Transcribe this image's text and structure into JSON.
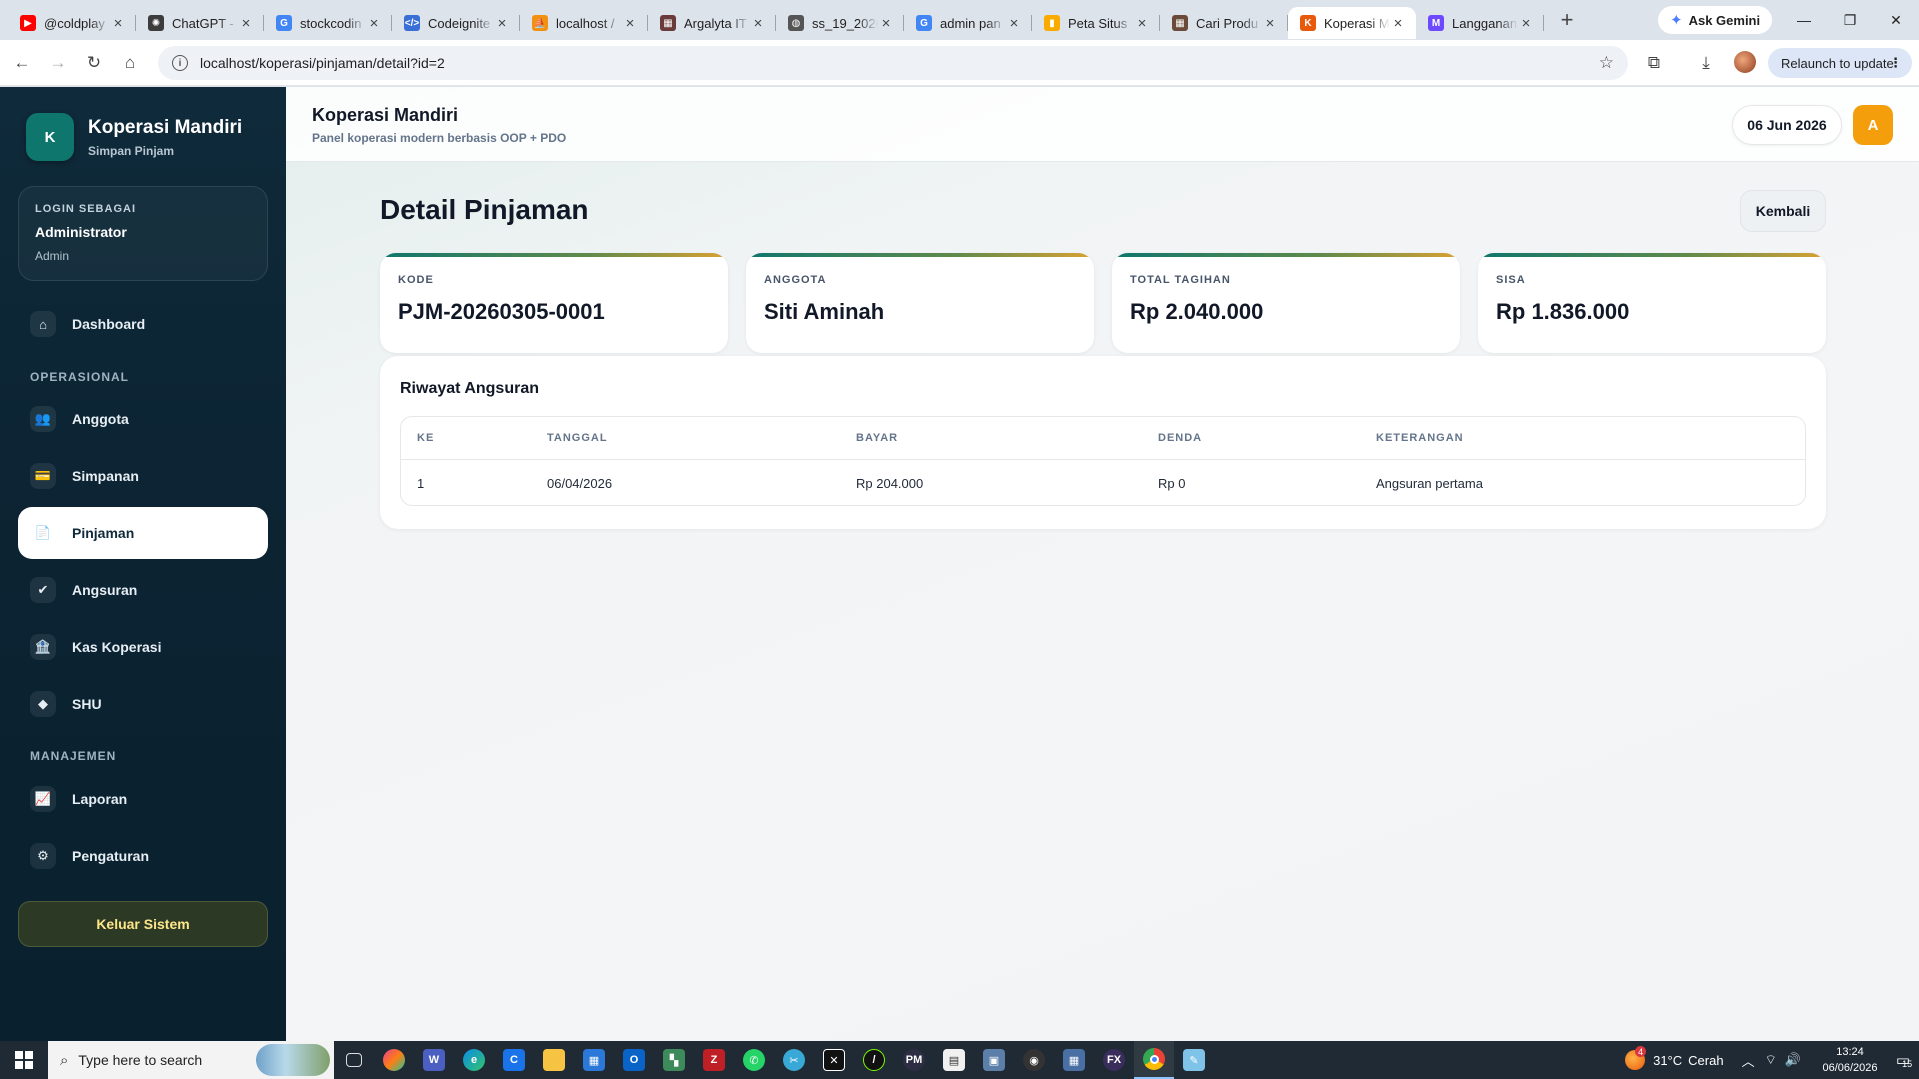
{
  "browser": {
    "tabs": [
      {
        "title": "@coldplay",
        "fav": "youtube-icon",
        "color": "#ff0000",
        "glyph": "▶"
      },
      {
        "title": "ChatGPT -",
        "fav": "chatgpt-icon",
        "color": "#3c3c3c",
        "glyph": "✺"
      },
      {
        "title": "stockcodin",
        "fav": "google-icon",
        "color": "#4285f4",
        "glyph": "G"
      },
      {
        "title": "Codeignite",
        "fav": "code-icon",
        "color": "#3b6fd8",
        "glyph": "</>"
      },
      {
        "title": "localhost /",
        "fav": "phpmyadmin-icon",
        "color": "#f29111",
        "glyph": "⛵"
      },
      {
        "title": "Argalyta IT",
        "fav": "page-icon",
        "color": "#6b3a3a",
        "glyph": "▦"
      },
      {
        "title": "ss_19_2026",
        "fav": "globe-icon",
        "color": "#555555",
        "glyph": "◍"
      },
      {
        "title": "admin pan",
        "fav": "google-icon",
        "color": "#4285f4",
        "glyph": "G"
      },
      {
        "title": "Peta Situs",
        "fav": "analytics-icon",
        "color": "#f9ab00",
        "glyph": "▮"
      },
      {
        "title": "Cari Produ",
        "fav": "page-icon",
        "color": "#6b4a3a",
        "glyph": "▦"
      },
      {
        "title": "Koperasi M",
        "fav": "koperasi-icon",
        "color": "#e8590c",
        "glyph": "K",
        "active": true
      },
      {
        "title": "Langganan",
        "fav": "shop-icon",
        "color": "#6d4aff",
        "glyph": "M"
      }
    ],
    "gemini_label": "Ask Gemini",
    "url": "localhost/koperasi/pinjaman/detail?id=2",
    "relaunch_label": "Relaunch to update"
  },
  "sidebar": {
    "brand_logo": "K",
    "brand_name": "Koperasi Mandiri",
    "brand_sub": "Simpan Pinjam",
    "login_label": "LOGIN SEBAGAI",
    "login_name": "Administrator",
    "login_role": "Admin",
    "dashboard": {
      "label": "Dashboard",
      "icon": "⌂"
    },
    "section_operasional": "OPERASIONAL",
    "anggota": {
      "label": "Anggota",
      "icon": "👥"
    },
    "simpanan": {
      "label": "Simpanan",
      "icon": "💳"
    },
    "pinjaman": {
      "label": "Pinjaman",
      "icon": "📄"
    },
    "angsuran": {
      "label": "Angsuran",
      "icon": "✔"
    },
    "kas": {
      "label": "Kas Koperasi",
      "icon": "🏦"
    },
    "shu": {
      "label": "SHU",
      "icon": "◆"
    },
    "section_manajemen": "MANAJEMEN",
    "laporan": {
      "label": "Laporan",
      "icon": "📈"
    },
    "pengaturan": {
      "label": "Pengaturan",
      "icon": "⚙"
    },
    "logout_label": "Keluar Sistem"
  },
  "header": {
    "title": "Koperasi Mandiri",
    "subtitle": "Panel koperasi modern berbasis OOP + PDO",
    "date": "06 Jun 2026",
    "avatar": "A"
  },
  "page": {
    "title": "Detail Pinjaman",
    "back_label": "Kembali",
    "stats": [
      {
        "label": "KODE",
        "value": "PJM-20260305-0001"
      },
      {
        "label": "ANGGOTA",
        "value": "Siti Aminah"
      },
      {
        "label": "TOTAL TAGIHAN",
        "value": "Rp 2.040.000"
      },
      {
        "label": "SISA",
        "value": "Rp 1.836.000"
      }
    ],
    "history_title": "Riwayat Angsuran",
    "columns": [
      "KE",
      "TANGGAL",
      "BAYAR",
      "DENDA",
      "KETERANGAN"
    ],
    "rows": [
      [
        "1",
        "06/04/2026",
        "Rp 204.000",
        "Rp 0",
        "Angsuran pertama"
      ]
    ]
  },
  "taskbar": {
    "search_placeholder": "Type here to search",
    "temperature": "31°C",
    "weather": "Cerah",
    "weather_badge": "4",
    "time": "13:24",
    "date": "06/06/2026",
    "notifications": "15"
  }
}
